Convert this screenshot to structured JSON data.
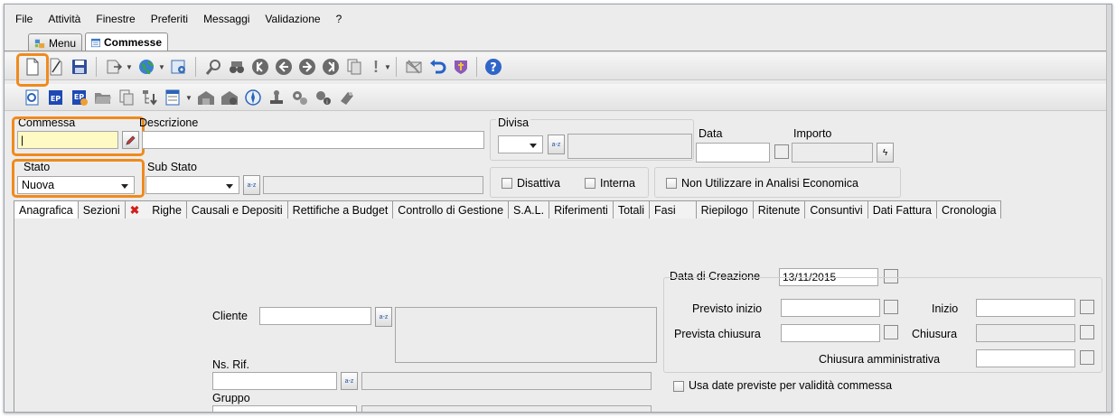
{
  "menu": [
    "File",
    "Attività",
    "Finestre",
    "Preferiti",
    "Messaggi",
    "Validazione",
    "?"
  ],
  "tabs": {
    "menu_label": "Menu",
    "commesse_label": "Commesse"
  },
  "header": {
    "commessa_label": "Commessa",
    "commessa_value": "",
    "descrizione_label": "Descrizione",
    "divisa_label": "Divisa",
    "data_label": "Data",
    "importo_label": "Importo",
    "stato_label": "Stato",
    "stato_value": "Nuova",
    "substato_label": "Sub Stato",
    "disattiva_label": "Disattiva",
    "interna_label": "Interna",
    "non_utilizzare_label": "Non Utilizzare in Analisi Economica"
  },
  "subtabs": [
    "Anagrafica",
    "Sezioni",
    "Righe",
    "Causali e Depositi",
    "Rettifiche a Budget",
    "Controllo di Gestione",
    "S.A.L.",
    "Riferimenti",
    "Totali",
    "Fasi",
    "Riepilogo",
    "Ritenute",
    "Consuntivi",
    "Dati Fattura",
    "Cronologia"
  ],
  "anagrafica": {
    "cliente_label": "Cliente",
    "nsrif_label": "Ns. Rif.",
    "gruppo_label": "Gruppo",
    "data_creazione_label": "Data di Creazione",
    "data_creazione_value": "13/11/2015",
    "previsto_inizio_label": "Previsto inizio",
    "inizio_label": "Inizio",
    "prevista_chiusura_label": "Prevista chiusura",
    "chiusura_label": "Chiusura",
    "chiusura_amm_label": "Chiusura amministrativa",
    "usa_date_label": "Usa date previste per validità commessa"
  },
  "colors": {
    "highlight": "#f08a1c",
    "required_field": "#fff9c4"
  }
}
